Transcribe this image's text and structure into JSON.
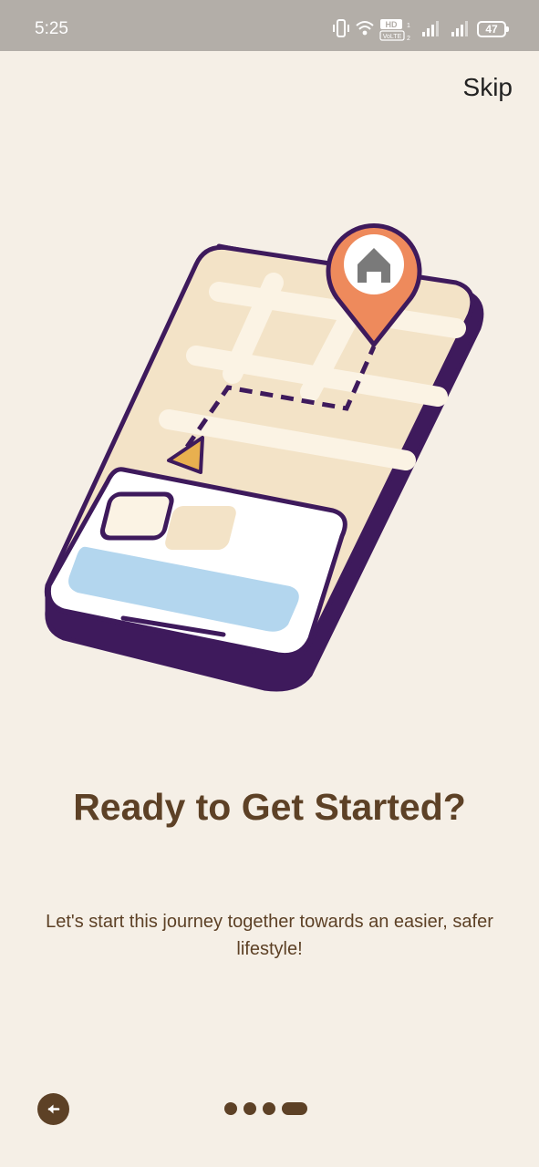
{
  "status_bar": {
    "time": "5:25",
    "hd_badge": "HD",
    "volte_badge": "VoLTE",
    "sim_one": "1",
    "sim_two": "2",
    "battery_level": "47"
  },
  "header": {
    "skip_label": "Skip"
  },
  "illustration": {
    "icons": [
      "smartphone-map-icon",
      "location-pin-icon",
      "home-icon",
      "navigation-arrow-icon"
    ]
  },
  "content": {
    "title": "Ready to Get Started?",
    "subtitle": "Let's start this journey together towards an easier, safer lifestyle!"
  },
  "footer": {
    "back_icon": "arrow-left-icon",
    "page_count": 4,
    "active_page": 4
  },
  "colors": {
    "background": "#f5efe6",
    "brand_brown": "#5d4126",
    "phone_purple": "#3e1a5c",
    "pin_orange": "#ee8a5c",
    "map_tan": "#f3e3c7",
    "card_blue": "#b3d6ee"
  }
}
